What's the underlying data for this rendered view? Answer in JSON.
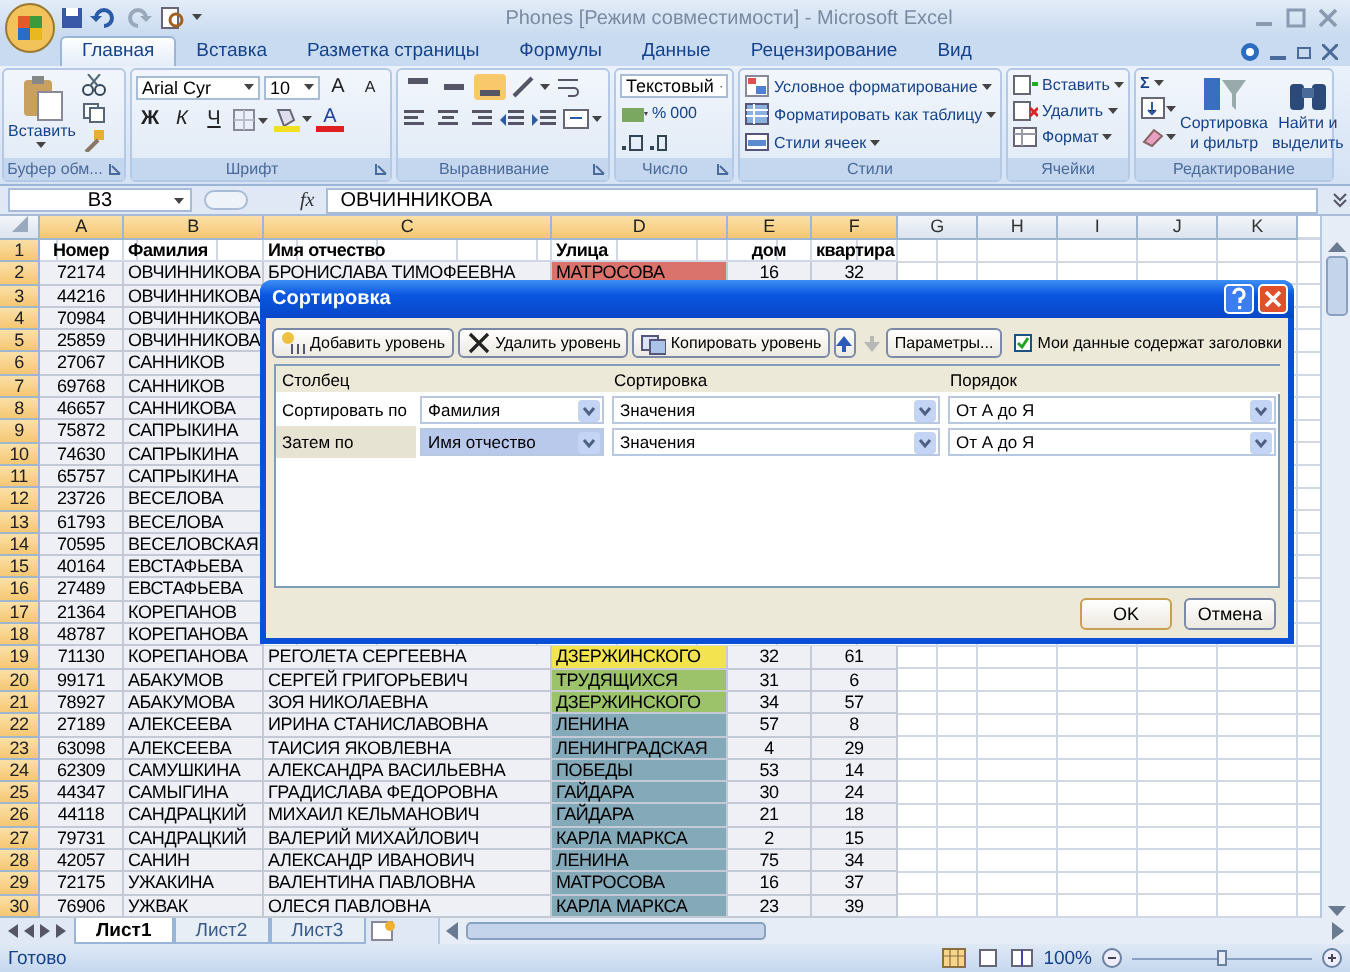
{
  "window": {
    "title": "Phones  [Режим совместимости] - Microsoft Excel"
  },
  "ribbon": {
    "tabs": [
      {
        "label": "Главная",
        "selected": true
      },
      {
        "label": "Вставка",
        "selected": false
      },
      {
        "label": "Разметка страницы",
        "selected": false
      },
      {
        "label": "Формулы",
        "selected": false
      },
      {
        "label": "Данные",
        "selected": false
      },
      {
        "label": "Рецензирование",
        "selected": false
      },
      {
        "label": "Вид",
        "selected": false
      }
    ],
    "clipboard": {
      "paste": "Вставить",
      "label": "Буфер обм..."
    },
    "font": {
      "name": "Arial Cyr",
      "size": "10",
      "grow": "A",
      "shrink": "A",
      "bold": "Ж",
      "italic": "К",
      "underline": "Ч",
      "font_color_label": "A",
      "label": "Шрифт"
    },
    "alignment": {
      "vertical": [
        {
          "selected": false
        },
        {
          "selected": false
        },
        {
          "selected": true
        }
      ],
      "label": "Выравнивание"
    },
    "number": {
      "format": "Текстовый",
      "percent": "%",
      "thousands": "000",
      "label": "Число"
    },
    "styles": {
      "items": [
        "Условное форматирование",
        "Форматировать как таблицу",
        "Стили ячеек"
      ],
      "label": "Стили"
    },
    "cells": {
      "items": [
        "Вставить",
        "Удалить",
        "Формат"
      ],
      "label": "Ячейки"
    },
    "editing": {
      "sum": "Σ",
      "sort": "Сортировка и фильтр",
      "find": "Найти и выделить",
      "label": "Редактирование"
    }
  },
  "formula_bar": {
    "name_box": "B3",
    "fx": "fx",
    "value": "ОВЧИННИКОВА"
  },
  "sheet": {
    "columns": [
      {
        "label": "A",
        "selected": true
      },
      {
        "label": "B",
        "selected": true
      },
      {
        "label": "C",
        "selected": true
      },
      {
        "label": "D",
        "selected": true
      },
      {
        "label": "E",
        "selected": true
      },
      {
        "label": "F",
        "selected": true
      },
      {
        "label": "G",
        "selected": false
      },
      {
        "label": "H",
        "selected": false
      },
      {
        "label": "I",
        "selected": false
      },
      {
        "label": "J",
        "selected": false
      },
      {
        "label": "K",
        "selected": false
      }
    ],
    "rows": [
      {
        "number": "1",
        "kind": "header",
        "selected": true,
        "cells": [
          "Номер",
          "Фамилия",
          "Имя отчество",
          "Улица",
          "дом",
          "квартира"
        ]
      },
      {
        "number": "2",
        "kind": "data",
        "selected": true,
        "cells": [
          "72174",
          "ОВЧИННИКОВА",
          "БРОНИСЛАВА ТИМОФЕЕВНА",
          "МАТРОСОВА",
          "16",
          "32"
        ],
        "color": "#d9736c"
      },
      {
        "number": "3",
        "kind": "data",
        "selected": true,
        "cells": [
          "44216",
          "ОВЧИННИКОВА"
        ]
      },
      {
        "number": "4",
        "kind": "data",
        "selected": true,
        "cells": [
          "70984",
          "ОВЧИННИКОВА"
        ]
      },
      {
        "number": "5",
        "kind": "data",
        "selected": true,
        "cells": [
          "25859",
          "ОВЧИННИКОВА"
        ]
      },
      {
        "number": "6",
        "kind": "data",
        "selected": true,
        "cells": [
          "27067",
          "САННИКОВ"
        ]
      },
      {
        "number": "7",
        "kind": "data",
        "selected": true,
        "cells": [
          "69768",
          "САННИКОВ"
        ]
      },
      {
        "number": "8",
        "kind": "data",
        "selected": true,
        "cells": [
          "46657",
          "САННИКОВА"
        ]
      },
      {
        "number": "9",
        "kind": "data",
        "selected": true,
        "cells": [
          "75872",
          "САПРЫКИНА"
        ]
      },
      {
        "number": "10",
        "kind": "data",
        "selected": true,
        "cells": [
          "74630",
          "САПРЫКИНА"
        ]
      },
      {
        "number": "11",
        "kind": "data",
        "selected": true,
        "cells": [
          "65757",
          "САПРЫКИНА"
        ]
      },
      {
        "number": "12",
        "kind": "data",
        "selected": true,
        "cells": [
          "23726",
          "ВЕСЕЛОВА"
        ]
      },
      {
        "number": "13",
        "kind": "data",
        "selected": true,
        "cells": [
          "61793",
          "ВЕСЕЛОВА"
        ]
      },
      {
        "number": "14",
        "kind": "data",
        "selected": true,
        "cells": [
          "70595",
          "ВЕСЕЛОВСКАЯ"
        ]
      },
      {
        "number": "15",
        "kind": "data",
        "selected": true,
        "cells": [
          "40164",
          "ЕВСТАФЬЕВА"
        ]
      },
      {
        "number": "16",
        "kind": "data",
        "selected": true,
        "cells": [
          "27489",
          "ЕВСТАФЬЕВА"
        ]
      },
      {
        "number": "17",
        "kind": "data",
        "selected": true,
        "cells": [
          "21364",
          "КОРЕПАНОВ"
        ]
      },
      {
        "number": "18",
        "kind": "data",
        "selected": true,
        "cells": [
          "48787",
          "КОРЕПАНОВА"
        ]
      },
      {
        "number": "19",
        "kind": "data",
        "selected": true,
        "cells": [
          "71130",
          "КОРЕПАНОВА",
          "РЕГОЛЕТА СЕРГЕЕВНА",
          "ДЗЕРЖИНСКОГО",
          "32",
          "61"
        ],
        "color": "#f3e44f"
      },
      {
        "number": "20",
        "kind": "data",
        "selected": true,
        "cells": [
          "99171",
          "АБАКУМОВ",
          "СЕРГЕЙ ГРИГОРЬЕВИЧ",
          "ТРУДЯЩИХСЯ",
          "31",
          "6"
        ],
        "color": "#9cc26a"
      },
      {
        "number": "21",
        "kind": "data",
        "selected": true,
        "cells": [
          "78927",
          "АБАКУМОВА",
          "ЗОЯ НИКОЛАЕВНА",
          "ДЗЕРЖИНСКОГО",
          "34",
          "57"
        ],
        "color": "#9cc26a"
      },
      {
        "number": "22",
        "kind": "data",
        "selected": true,
        "cells": [
          "27189",
          "АЛЕКСЕЕВА",
          "ИРИНА СТАНИСЛАВОВНА",
          "ЛЕНИНА",
          "57",
          "8"
        ],
        "color": "#84a9b8"
      },
      {
        "number": "23",
        "kind": "data",
        "selected": true,
        "cells": [
          "63098",
          "АЛЕКСЕЕВА",
          "ТАИСИЯ ЯКОВЛЕВНА",
          "ЛЕНИНГРАДСКАЯ",
          "4",
          "29"
        ],
        "color": "#84a9b8"
      },
      {
        "number": "24",
        "kind": "data",
        "selected": true,
        "cells": [
          "62309",
          "САМУШКИНА",
          "АЛЕКСАНДРА ВАСИЛЬЕВНА",
          "ПОБЕДЫ",
          "53",
          "14"
        ],
        "color": "#84a9b8"
      },
      {
        "number": "25",
        "kind": "data",
        "selected": true,
        "cells": [
          "44347",
          "САМЫГИНА",
          "ГРАДИСЛАВА ФЕДОРОВНА",
          "ГАЙДАРА",
          "30",
          "24"
        ],
        "color": "#84a9b8"
      },
      {
        "number": "26",
        "kind": "data",
        "selected": true,
        "cells": [
          "44118",
          "САНДРАЦКИЙ",
          "МИХАИЛ КЕЛЬМАНОВИЧ",
          "ГАЙДАРА",
          "21",
          "18"
        ],
        "color": "#84a9b8"
      },
      {
        "number": "27",
        "kind": "data",
        "selected": true,
        "cells": [
          "79731",
          "САНДРАЦКИЙ",
          "ВАЛЕРИЙ МИХАЙЛОВИЧ",
          "КАРЛА МАРКСА",
          "2",
          "15"
        ],
        "color": "#84a9b8"
      },
      {
        "number": "28",
        "kind": "data",
        "selected": true,
        "cells": [
          "42057",
          "САНИН",
          "АЛЕКСАНДР ИВАНОВИЧ",
          "ЛЕНИНА",
          "75",
          "34"
        ],
        "color": "#84a9b8"
      },
      {
        "number": "29",
        "kind": "data",
        "selected": true,
        "cells": [
          "72175",
          "УЖАКИНА",
          "ВАЛЕНТИНА ПАВЛОВНА",
          "МАТРОСОВА",
          "16",
          "37"
        ],
        "color": "#84a9b8"
      },
      {
        "number": "30",
        "kind": "data",
        "selected": true,
        "cells": [
          "76906",
          "УЖВАК",
          "ОЛЕСЯ ПАВЛОВНА",
          "КАРЛА МАРКСА",
          "23",
          "39"
        ],
        "color": "#84a9b8"
      }
    ]
  },
  "sheet_tabs": [
    {
      "label": "Лист1",
      "selected": true
    },
    {
      "label": "Лист2",
      "selected": false
    },
    {
      "label": "Лист3",
      "selected": false
    }
  ],
  "status_bar": {
    "text": "Готово",
    "zoom": "100%",
    "zoom_slider": {
      "level": 0.5
    }
  },
  "dialog": {
    "title": "Сортировка",
    "toolbar": [
      {
        "kind": "add",
        "label": "Добавить уровень"
      },
      {
        "kind": "delete",
        "label": "Удалить уровень"
      },
      {
        "kind": "copy",
        "label": "Копировать уровень"
      }
    ],
    "move_up": {
      "disabled": false
    },
    "move_down": {
      "disabled": true
    },
    "options": "Параметры...",
    "headers_checkbox": {
      "label": "Мои данные содержат заголовки",
      "checked": true
    },
    "columns": [
      "Столбец",
      "Сортировка",
      "Порядок"
    ],
    "levels": [
      {
        "label": "Сортировать по",
        "column": "Фамилия",
        "sort_on": "Значения",
        "order": "От А до Я",
        "selected": false
      },
      {
        "label": "Затем по",
        "column": "Имя отчество",
        "sort_on": "Значения",
        "order": "От А до Я",
        "selected": true
      }
    ],
    "buttons": [
      "OK",
      "Отмена"
    ]
  }
}
